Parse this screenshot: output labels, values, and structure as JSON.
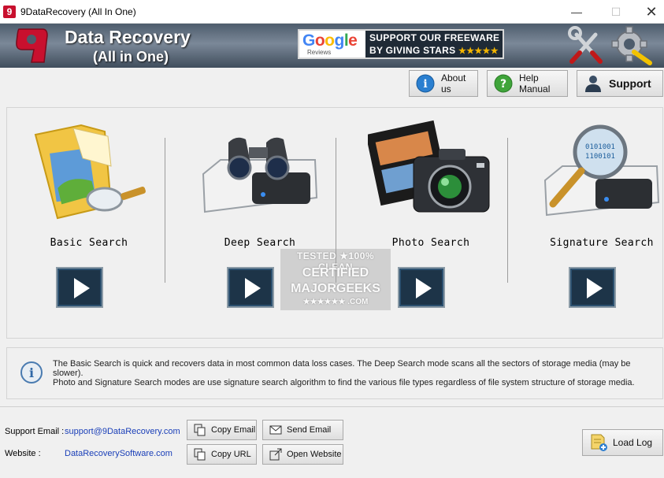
{
  "window": {
    "title": "9DataRecovery (All In One)",
    "app_icon_glyph": "9",
    "minimize_glyph": "—",
    "maximize_glyph": "☐",
    "close_glyph": "✕"
  },
  "banner": {
    "brand_line1": "Data Recovery",
    "brand_line2": "(All in One)",
    "google_word": "Google",
    "google_reviews": "Reviews",
    "support_line1": "SUPPORT OUR FREEWARE",
    "support_line2": "BY GIVING STARS",
    "stars": "★★★★★"
  },
  "top_buttons": {
    "about": "About us",
    "help": "Help Manual",
    "support": "Support"
  },
  "searches": [
    {
      "label": "Basic Search"
    },
    {
      "label": "Deep Search"
    },
    {
      "label": "Photo Search"
    },
    {
      "label": "Signature Search"
    }
  ],
  "watermark": {
    "line1": "TESTED ★100% CLEAN",
    "line2": "CERTIFIED",
    "line3": "MAJORGEEKS",
    "line4": "★★★★★★ .COM"
  },
  "info": {
    "line1": "The Basic Search is quick and recovers data in most common data loss cases. The Deep Search mode scans all the sectors of storage media (may be slower).",
    "line2": "Photo and Signature Search modes are use signature search algorithm to find the various file types regardless of file system structure of storage media."
  },
  "footer": {
    "email_label": "Support Email :",
    "email_value": "support@9DataRecovery.com",
    "website_label": "Website :",
    "website_value": "DataRecoverySoftware.com",
    "copy_email": "Copy Email",
    "send_email": "Send Email",
    "copy_url": "Copy URL",
    "open_website": "Open Website",
    "load_log": "Load Log"
  },
  "colors": {
    "banner_dark": "#3f4d5c",
    "accent_red": "#c8102e",
    "link_blue": "#1a3fb8",
    "play_dark": "#1d3448"
  }
}
